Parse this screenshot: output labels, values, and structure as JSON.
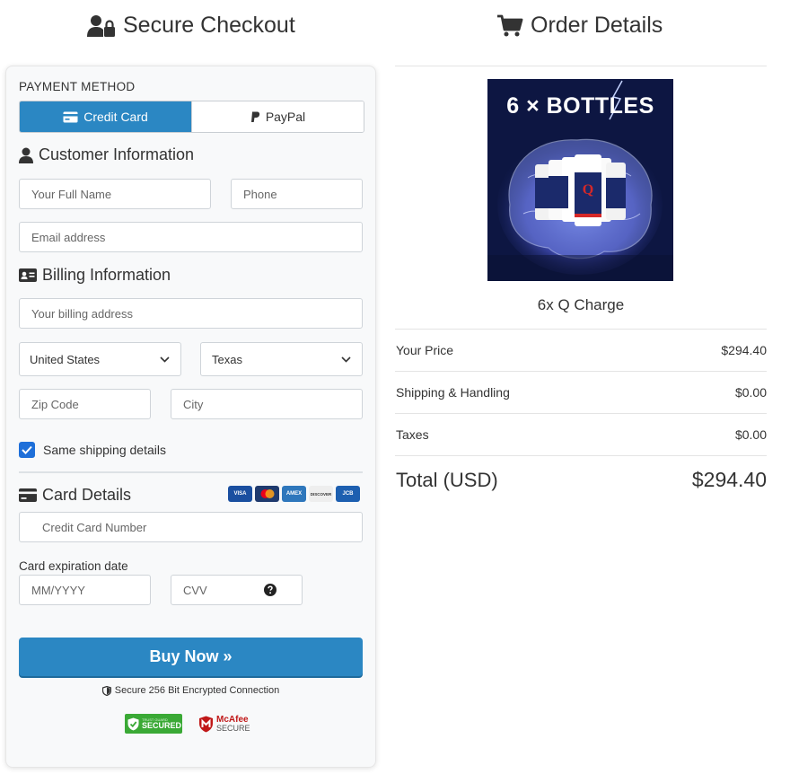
{
  "checkout": {
    "title": "Secure Checkout",
    "payment_method_label": "PAYMENT METHOD",
    "tabs": [
      {
        "label": "Credit Card",
        "active": true
      },
      {
        "label": "PayPal",
        "active": false
      }
    ],
    "customer_section_title": "Customer Information",
    "name_placeholder": "Your Full Name",
    "phone_placeholder": "Phone",
    "email_placeholder": "Email address",
    "billing_section_title": "Billing Information",
    "address_placeholder": "Your billing address",
    "country_value": "United States",
    "state_value": "Texas",
    "zip_placeholder": "Zip Code",
    "city_placeholder": "City",
    "same_shipping_label": "Same shipping details",
    "same_shipping_checked": true,
    "card_section_title": "Card Details",
    "card_logos": [
      "VISA",
      "mastercard",
      "AMEX",
      "DISCOVER",
      "JCB"
    ],
    "card_number_placeholder": "Credit Card Number",
    "expiration_label": "Card expiration date",
    "expiry_placeholder": "MM/YYYY",
    "cvv_placeholder": "CVV",
    "buy_button_label": "Buy Now »",
    "secure_connection_text": "Secure 256 Bit Encrypted Connection",
    "badge_secured_top": "TRUST GUARD",
    "badge_secured_label": "SECURED",
    "badge_mcafee_label": "McAfee",
    "badge_mcafee_sub": "SECURE"
  },
  "order": {
    "title": "Order Details",
    "product_image_text": "6 × BOTTLES",
    "product_name": "6x Q Charge",
    "rows": [
      {
        "label": "Your Price",
        "value": "$294.40"
      },
      {
        "label": "Shipping & Handling",
        "value": "$0.00"
      },
      {
        "label": "Taxes",
        "value": "$0.00"
      }
    ],
    "total_label": "Total (USD)",
    "total_value": "$294.40"
  },
  "colors": {
    "accent": "#2b87c3",
    "checkbox": "#1e6fd9",
    "text": "#333333"
  }
}
